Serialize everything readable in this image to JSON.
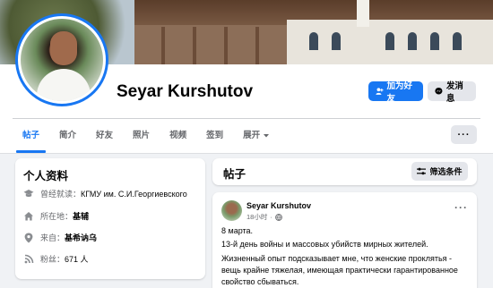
{
  "profile": {
    "name": "Seyar Kurshutov",
    "add_friend_label": "加为好友",
    "message_label": "发消息"
  },
  "tabs": [
    {
      "label": "帖子",
      "active": true
    },
    {
      "label": "简介"
    },
    {
      "label": "好友"
    },
    {
      "label": "照片"
    },
    {
      "label": "视频"
    },
    {
      "label": "签到"
    },
    {
      "label": "展开"
    }
  ],
  "more_label": "···",
  "intro": {
    "title": "个人资料",
    "education_prefix": "曾经就读：",
    "education": "КГМУ им. С.И.Георгиевского",
    "location_prefix": "所在地：",
    "location": "基辅",
    "from_prefix": "来自：",
    "from": "基希讷乌",
    "followers_prefix": "粉丝：",
    "followers": "671 人"
  },
  "posts_section": {
    "title": "帖子",
    "filter_label": "筛选条件"
  },
  "post": {
    "author": "Seyar Kurshutov",
    "time": "18小时",
    "date": "8 марта.",
    "para1": "13-й день войны и массовых убийств мирных жителей.",
    "para2": "Жизненный опыт подсказывает мне, что женские проклятья - вещь крайне тяжелая, имеющая практически гарантированное свойство сбываться."
  },
  "colors": {
    "accent": "#1877f2",
    "background": "#f0f2f5",
    "button_gray": "#e4e6eb"
  },
  "icons": [
    "user-plus-icon",
    "messenger-icon",
    "graduation-cap-icon",
    "home-icon",
    "location-pin-icon",
    "rss-icon",
    "filter-icon",
    "globe-icon",
    "chevron-down-icon"
  ]
}
